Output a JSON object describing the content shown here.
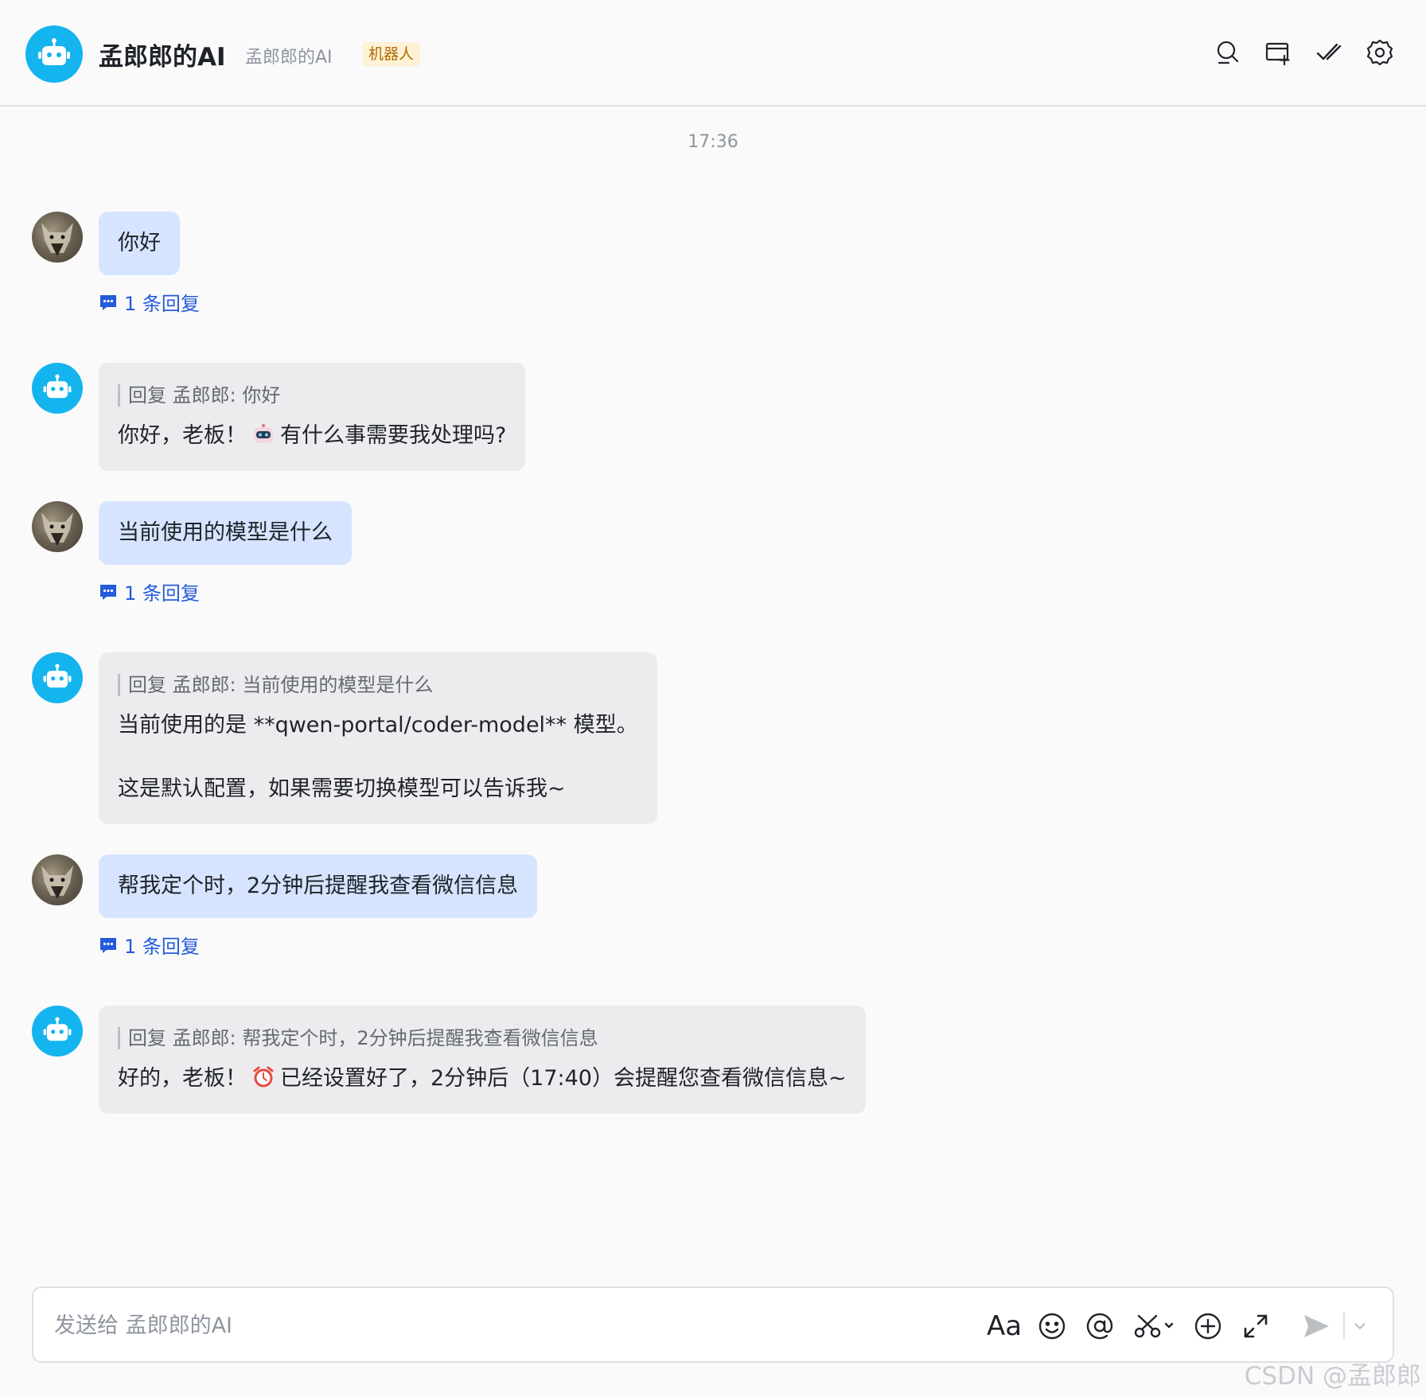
{
  "header": {
    "title": "孟郎郎的AI",
    "subtitle": "孟郎郎的AI",
    "badge": "机器人",
    "icons": [
      "search-icon",
      "add-to-chat-icon",
      "done-icon",
      "settings-icon"
    ]
  },
  "timestamp": "17:36",
  "messages": [
    {
      "sender": "user",
      "text": "你好",
      "reply_count": "1 条回复"
    },
    {
      "sender": "bot",
      "quote": "回复 孟郎郎: 你好",
      "text_before": "你好，老板！",
      "emoji": "robot-emoji",
      "text_after": "有什么事需要我处理吗?"
    },
    {
      "sender": "user",
      "text": "当前使用的模型是什么",
      "reply_count": "1 条回复"
    },
    {
      "sender": "bot",
      "quote": "回复 孟郎郎: 当前使用的模型是什么",
      "line1": "当前使用的是 **qwen-portal/coder-model** 模型。",
      "line2": "这是默认配置，如果需要切换模型可以告诉我~"
    },
    {
      "sender": "user",
      "text": "帮我定个时，2分钟后提醒我查看微信信息",
      "reply_count": "1 条回复"
    },
    {
      "sender": "bot",
      "quote": "回复 孟郎郎: 帮我定个时，2分钟后提醒我查看微信信息",
      "text_before": "好的，老板！",
      "emoji": "alarm-clock-emoji",
      "text_after": "已经设置好了，2分钟后（17:40）会提醒您查看微信信息~"
    }
  ],
  "composer": {
    "placeholder": "发送给 孟郎郎的AI",
    "font_button": "Aa",
    "tools": [
      "font-icon",
      "emoji-icon",
      "mention-icon",
      "screenshot-icon",
      "more-icon",
      "expand-icon",
      "send-icon",
      "send-options-icon"
    ]
  },
  "colors": {
    "accent": "#245bdb",
    "bot_avatar": "#14b4ef",
    "user_bubble": "#d6e4ff",
    "bot_bubble": "#ececee",
    "badge_bg": "#fdf1d6",
    "badge_text": "#b26a00"
  },
  "watermark": "CSDN @孟郎郎"
}
